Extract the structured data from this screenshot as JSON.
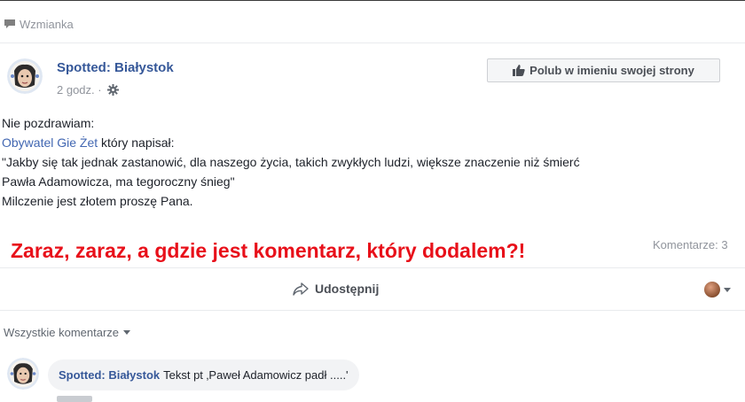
{
  "mention": {
    "label": "Wzmianka",
    "icon": "comment-icon"
  },
  "post": {
    "page_name": "Spotted: Białystok",
    "time": "2 godz.",
    "audience_icon": "gear-icon",
    "like_button": "Polub w imieniu swojej strony",
    "body": {
      "line1": "Nie pozdrawiam:",
      "mention_link": "Obywatel Gie Żet",
      "mention_rest": " który napisał:",
      "line3": "\"Jakby się tak jednak zastanowić, dla naszego życia, takich zwykłych ludzi, większe znaczenie niż śmierć",
      "line4": "Pawła Adamowicza, ma tegoroczny śnieg\"",
      "line5": "Milczenie jest złotem proszę Pana."
    }
  },
  "annotation": "Zaraz, zaraz, a gdzie jest komentarz, który dodalem?!",
  "comments_count": "Komentarze: 3",
  "share_label": "Udostępnij",
  "all_comments": "Wszystkie komentarze",
  "comment": {
    "author": "Spotted: Białystok",
    "text": "Tekst pt ‚Paweł Adamowicz padł .....'"
  },
  "colors": {
    "link": "#365899",
    "annotation": "#e8101a",
    "meta": "#90949c"
  }
}
